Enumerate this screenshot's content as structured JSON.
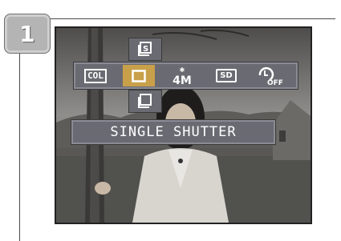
{
  "step": {
    "number": "1"
  },
  "menu": {
    "items": [
      {
        "label": "COL",
        "icon": "color-mode-icon",
        "selected": false
      },
      {
        "label": "",
        "icon": "single-shutter-icon",
        "selected": true
      },
      {
        "label": "4M",
        "icon": "image-size-4m-icon",
        "selected": false
      },
      {
        "label": "SD",
        "icon": "sd-card-icon",
        "selected": false
      },
      {
        "label": "OFF",
        "icon": "self-timer-off-icon",
        "selected": false
      }
    ],
    "above_option": {
      "icon": "sequence-shutter-icon"
    },
    "below_option": {
      "icon": "continuous-shutter-icon"
    },
    "highlight_color": "#c9a04a",
    "panel_color": "#6a6a72"
  },
  "mode_label": {
    "text": "SINGLE SHUTTER"
  }
}
